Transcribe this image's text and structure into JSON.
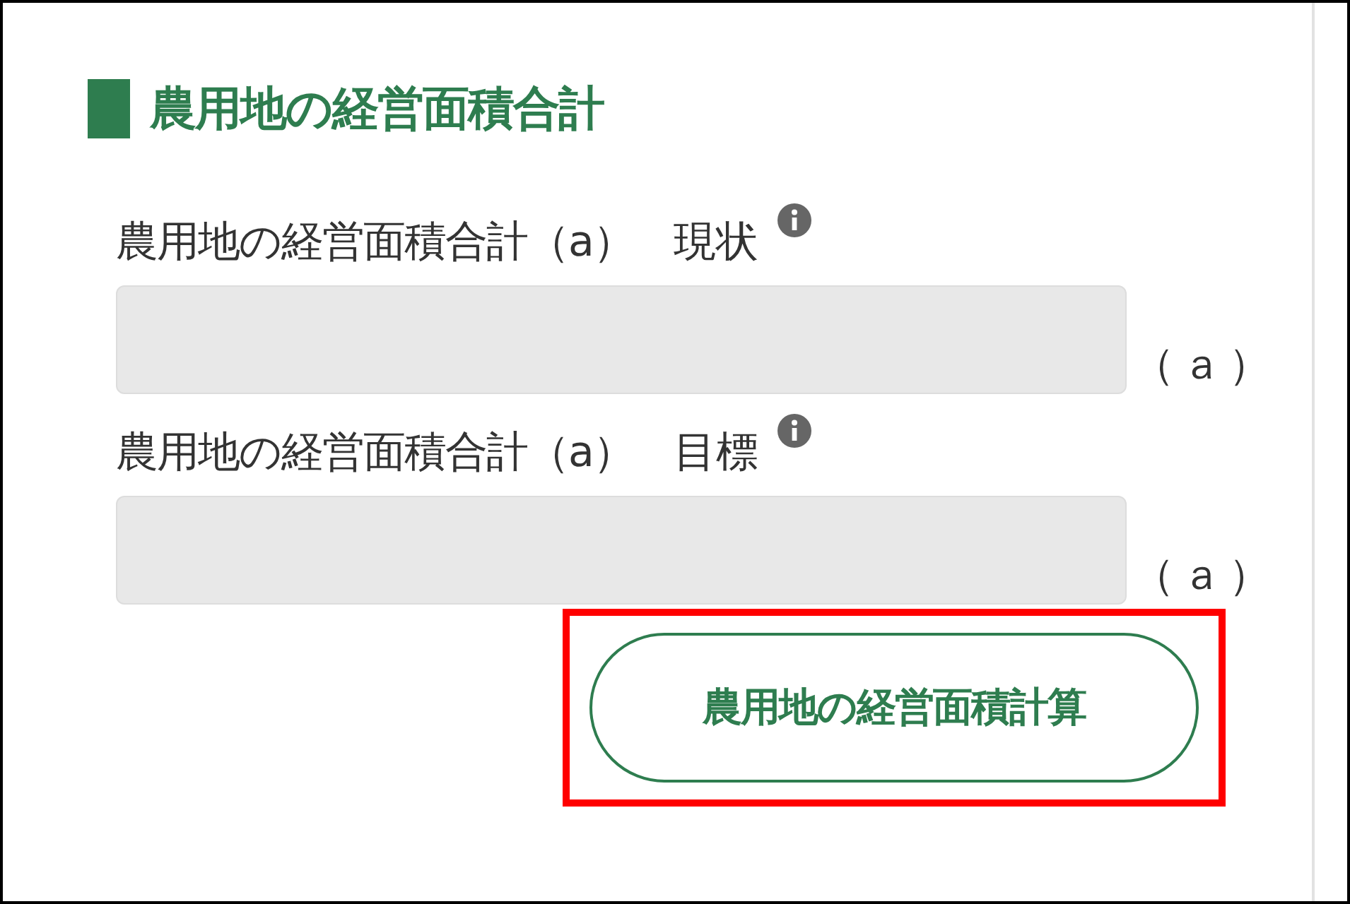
{
  "section": {
    "title": "農用地の経営面積合計"
  },
  "fields": [
    {
      "label": "農用地の経営面積合計（a）",
      "qualifier": "現状",
      "info": true,
      "unit": "（ａ）"
    },
    {
      "label": "農用地の経営面積合計（a）",
      "qualifier": "目標",
      "info": true,
      "unit": "（ａ）"
    }
  ],
  "button": {
    "label": "農用地の経営面積計算",
    "highlighted": true
  }
}
